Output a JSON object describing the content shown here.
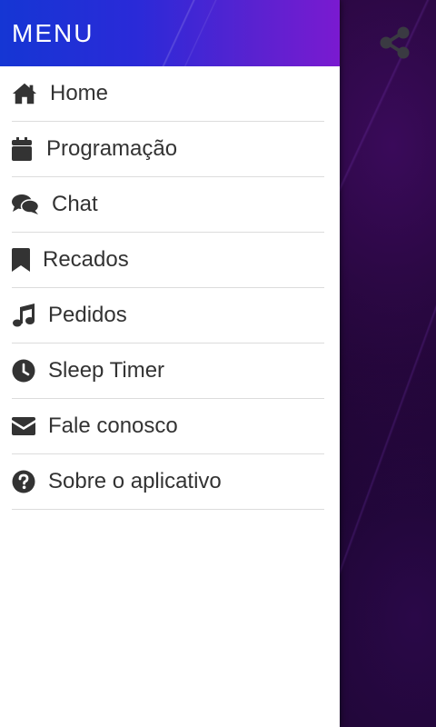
{
  "drawer": {
    "title": "MENU",
    "items": [
      {
        "label": "Home",
        "icon": "home-icon"
      },
      {
        "label": "Programação",
        "icon": "calendar-icon"
      },
      {
        "label": "Chat",
        "icon": "chat-icon"
      },
      {
        "label": "Recados",
        "icon": "bookmark-icon"
      },
      {
        "label": "Pedidos",
        "icon": "music-note-icon"
      },
      {
        "label": "Sleep Timer",
        "icon": "clock-icon"
      },
      {
        "label": "Fale conosco",
        "icon": "envelope-icon"
      },
      {
        "label": "Sobre o aplicativo",
        "icon": "question-circle-icon"
      }
    ]
  },
  "appbar": {
    "share_icon": "share-icon"
  },
  "colors": {
    "header_gradient_start": "#1536d4",
    "header_gradient_end": "#7a1ad0",
    "icon_color": "#333333",
    "text_color": "#333333",
    "divider": "#dcdcdc",
    "background_dark": "#10031c"
  }
}
